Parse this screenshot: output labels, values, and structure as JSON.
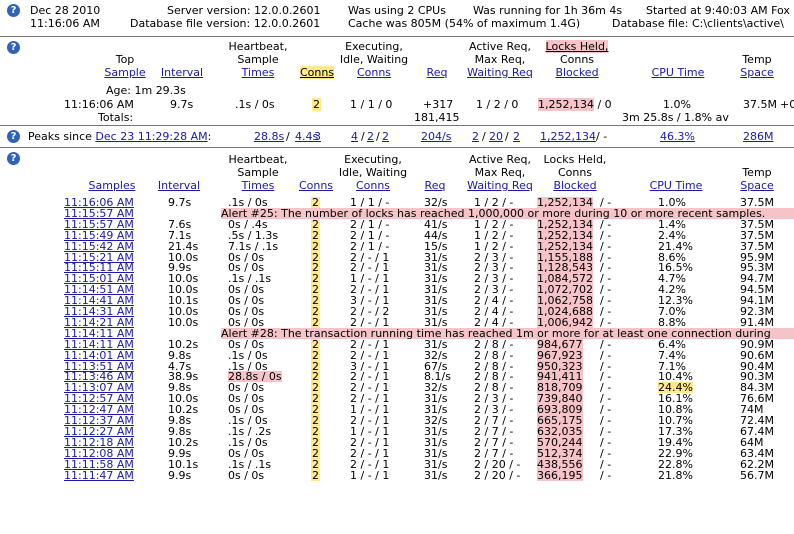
{
  "top": {
    "date": "Dec 28 2010",
    "time": "11:16:06 AM",
    "server_version": "Server version: 12.0.0.2601",
    "db_file_version": "Database file version: 12.0.0.2601",
    "cpus": "Was using 2 CPUs",
    "cache": "Cache was 805M (54% of maximum 1.4G)",
    "running": "Was running for 1h 36m 4s",
    "db_file": "Database file: C:\\clients\\active\\",
    "started": "Started at 9:40:03 AM Fox"
  },
  "headers": {
    "sample": [
      "Top",
      "Sample"
    ],
    "samples": "Samples",
    "interval": "Interval",
    "heartbeat": [
      "Heartbeat,",
      "Sample",
      "Times"
    ],
    "conns": "Conns",
    "executing": [
      "Executing,",
      "Idle, Waiting",
      "Conns"
    ],
    "req": "Req",
    "active_req": [
      "Active Req,",
      "Max Req,",
      "Waiting Req"
    ],
    "locks": [
      "Locks Held,",
      "Conns",
      "Blocked"
    ],
    "cpu": "CPU Time",
    "temp": [
      "Temp",
      "Space"
    ]
  },
  "current": {
    "age": "Age: 1m 29.3s",
    "time": "11:16:06 AM",
    "interval": "9.7s",
    "heartbeat": ".1s / 0s",
    "conns": "2",
    "executing": "1 / 1 / 0",
    "req": "+317",
    "req_total": "181,415",
    "active": "1 / 2 / 0",
    "locks": "1,252,134",
    "locks_blocked": " / 0",
    "cpu": "1.0%",
    "cpu_total": "3m 25.8s / 1.8% av",
    "temp": "37.5M",
    "extra": "+0",
    "totals_label": "Totals:"
  },
  "peaks": {
    "label": "Peaks since",
    "since": "Dec 23 11:29:28 AM",
    "sep": ":",
    "heartbeat_a": "28.8s",
    "heartbeat_b": "4.4s",
    "conns": "3",
    "exec_a": "4",
    "exec_b": "2",
    "exec_c": "2",
    "req": "204/s",
    "active_a": "2",
    "active_b": "20",
    "active_c": "2",
    "locks": "1,252,134",
    "locks_rest": " / -",
    "cpu": "46.3%",
    "temp": "286M"
  },
  "samples": [
    {
      "time": "11:16:06 AM",
      "interval": "9.7s",
      "hb": ".1s / 0s",
      "conns": "2",
      "exec": "1 / 1 / -",
      "req": "32/s",
      "active": "1 / 2 / -",
      "locks": "1,252,134",
      "cpu": "1.0%",
      "temp": "37.5M"
    },
    {
      "time": "11:15:57 AM",
      "alert": "Alert #25: The number of locks has reached 1,000,000 or more during 10 or more recent samples."
    },
    {
      "time": "11:15:57 AM",
      "interval": "7.6s",
      "hb": "0s / .4s",
      "conns": "2",
      "exec": "2 / 1 / -",
      "req": "41/s",
      "active": "1 / 2 / -",
      "locks": "1,252,134",
      "cpu": "1.4%",
      "temp": "37.5M"
    },
    {
      "time": "11:15:49 AM",
      "interval": "7.1s",
      "hb": ".5s / 1.3s",
      "conns": "2",
      "exec": "2 / 1 / -",
      "req": "44/s",
      "active": "1 / 2 / -",
      "locks": "1,252,134",
      "cpu": "2.4%",
      "temp": "37.5M"
    },
    {
      "time": "11:15:42 AM",
      "interval": "21.4s",
      "hb": "7.1s / .1s",
      "conns": "2",
      "exec": "2 / 1 / -",
      "req": "15/s",
      "active": "1 / 2 / -",
      "locks": "1,252,134",
      "cpu": "21.4%",
      "temp": "37.5M"
    },
    {
      "time": "11:15:21 AM",
      "interval": "10.0s",
      "hb": "0s / 0s",
      "conns": "2",
      "exec": "2 / - / 1",
      "req": "31/s",
      "active": "2 / 3 / -",
      "locks": "1,155,188",
      "cpu": "8.6%",
      "temp": "95.9M"
    },
    {
      "time": "11:15:11 AM",
      "interval": "9.9s",
      "hb": "0s / 0s",
      "conns": "2",
      "exec": "2 / - / 1",
      "req": "31/s",
      "active": "2 / 3 / -",
      "locks": "1,128,543",
      "cpu": "16.5%",
      "temp": "95.3M"
    },
    {
      "time": "11:15:01 AM",
      "interval": "10.0s",
      "hb": ".1s / .1s",
      "conns": "2",
      "exec": "1 / - / 1",
      "req": "31/s",
      "active": "2 / 3 / -",
      "locks": "1,084,572",
      "cpu": "4.7%",
      "temp": "94.7M"
    },
    {
      "time": "11:14:51 AM",
      "interval": "10.0s",
      "hb": "0s / 0s",
      "conns": "2",
      "exec": "2 / - / 1",
      "req": "31/s",
      "active": "2 / 3 / -",
      "locks": "1,072,702",
      "cpu": "4.2%",
      "temp": "94.5M"
    },
    {
      "time": "11:14:41 AM",
      "interval": "10.1s",
      "hb": "0s / 0s",
      "conns": "2",
      "exec": "3 / - / 1",
      "req": "31/s",
      "active": "2 / 4 / -",
      "locks": "1,062,758",
      "cpu": "12.3%",
      "temp": "94.1M"
    },
    {
      "time": "11:14:31 AM",
      "interval": "10.0s",
      "hb": "0s / 0s",
      "conns": "2",
      "exec": "2 / - / 2",
      "req": "31/s",
      "active": "2 / 4 / -",
      "locks": "1,024,688",
      "cpu": "7.0%",
      "temp": "92.3M"
    },
    {
      "time": "11:14:21 AM",
      "interval": "10.0s",
      "hb": "0s / 0s",
      "conns": "2",
      "exec": "2 / - / 1",
      "req": "31/s",
      "active": "2 / 4 / -",
      "locks": "1,006,942",
      "cpu": "8.8%",
      "temp": "91.4M"
    },
    {
      "time": "11:14:11 AM",
      "alert": "Alert #28: The transaction running time has reached 1m or more for at least one connection during"
    },
    {
      "time": "11:14:11 AM",
      "interval": "10.2s",
      "hb": "0s / 0s",
      "conns": "2",
      "exec": "2 / - / 1",
      "req": "31/s",
      "active": "2 / 8 / -",
      "locks": "984,677",
      "cpu": "6.4%",
      "temp": "90.9M"
    },
    {
      "time": "11:14:01 AM",
      "interval": "9.8s",
      "hb": ".1s / 0s",
      "conns": "2",
      "exec": "2 / - / 1",
      "req": "32/s",
      "active": "2 / 8 / -",
      "locks": "967,923",
      "cpu": "7.4%",
      "temp": "90.6M"
    },
    {
      "time": "11:13:51 AM",
      "interval": "4.7s",
      "hb": ".1s / 0s",
      "conns": "2",
      "exec": "3 / - / 1",
      "req": "67/s",
      "active": "2 / 8 / -",
      "locks": "950,323",
      "cpu": "7.1%",
      "temp": "90.4M"
    },
    {
      "time": "11:13:46 AM",
      "interval": "38.9s",
      "hb": "28.8s / 0s",
      "hbHi": true,
      "conns": "2",
      "exec": "2 / - / 1",
      "req": "8.1/s",
      "active": "2 / 8 / -",
      "locks": "941,411",
      "cpu": "10.4%",
      "temp": "90.3M"
    },
    {
      "time": "11:13:07 AM",
      "interval": "9.8s",
      "hb": "0s / 0s",
      "conns": "2",
      "exec": "2 / - / 1",
      "req": "32/s",
      "active": "2 / 8 / -",
      "locks": "818,709",
      "cpu": "24.4%",
      "cpuHi": true,
      "temp": "84.3M"
    },
    {
      "time": "11:12:57 AM",
      "interval": "10.0s",
      "hb": "0s / 0s",
      "conns": "2",
      "exec": "2 / - / 1",
      "req": "31/s",
      "active": "2 / 3 / -",
      "locks": "739,840",
      "cpu": "16.1%",
      "temp": "76.6M"
    },
    {
      "time": "11:12:47 AM",
      "interval": "10.2s",
      "hb": "0s / 0s",
      "conns": "2",
      "exec": "1 / - / 1",
      "req": "31/s",
      "active": "2 / 3 / -",
      "locks": "693,809",
      "cpu": "10.8%",
      "temp": "74M"
    },
    {
      "time": "11:12:37 AM",
      "interval": "9.8s",
      "hb": ".1s / 0s",
      "conns": "2",
      "exec": "2 / - / 1",
      "req": "32/s",
      "active": "2 / 7 / -",
      "locks": "665,175",
      "cpu": "10.7%",
      "temp": "72.4M"
    },
    {
      "time": "11:12:27 AM",
      "interval": "9.8s",
      "hb": ".1s / .2s",
      "conns": "2",
      "exec": "1 / - / 1",
      "req": "31/s",
      "active": "2 / 7 / -",
      "locks": "632,035",
      "cpu": "17.3%",
      "temp": "67.4M"
    },
    {
      "time": "11:12:18 AM",
      "interval": "10.2s",
      "hb": ".1s / 0s",
      "conns": "2",
      "exec": "2 / - / 1",
      "req": "31/s",
      "active": "2 / 7 / -",
      "locks": "570,244",
      "cpu": "19.4%",
      "temp": "64M"
    },
    {
      "time": "11:12:08 AM",
      "interval": "9.9s",
      "hb": "0s / 0s",
      "conns": "2",
      "exec": "2 / - / 1",
      "req": "31/s",
      "active": "2 / 7 / -",
      "locks": "512,374",
      "cpu": "22.9%",
      "temp": "63.4M"
    },
    {
      "time": "11:11:58 AM",
      "interval": "10.1s",
      "hb": ".1s / .1s",
      "conns": "2",
      "exec": "2 / - / 1",
      "req": "31/s",
      "active": "2 / 20 / -",
      "locks": "438,556",
      "cpu": "22.8%",
      "temp": "62.2M"
    },
    {
      "time": "11:11:47 AM",
      "interval": "9.9s",
      "hb": "0s / 0s",
      "conns": "2",
      "exec": "1 / - / 1",
      "req": "31/s",
      "active": "2 / 20 / -",
      "locks": "366,195",
      "cpu": "21.8%",
      "temp": "56.7M"
    }
  ],
  "icon_names": [
    "help-icon"
  ],
  "colors": {
    "alert_pink": "#f6c3c9",
    "highlight_yellow": "#ffe98a",
    "link_blue": "#1a1aa6"
  }
}
